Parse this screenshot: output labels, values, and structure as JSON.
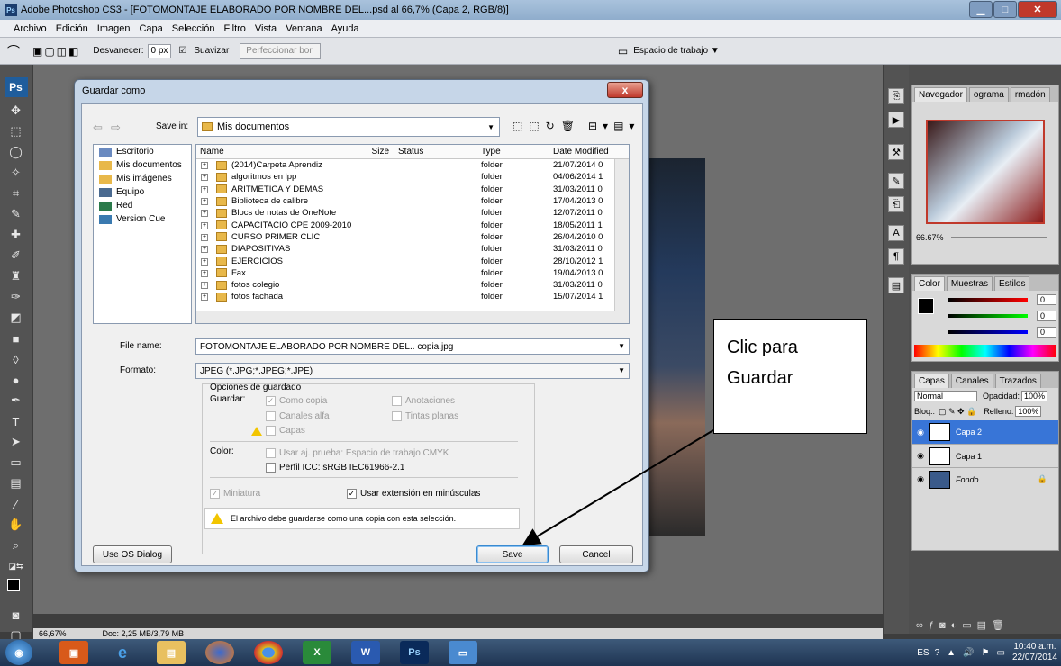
{
  "window": {
    "title": "Adobe Photoshop CS3 - [FOTOMONTAJE ELABORADO POR NOMBRE DEL...psd al 66,7% (Capa 2, RGB/8)]",
    "app_icon": "Ps"
  },
  "menu": [
    "Archivo",
    "Edición",
    "Imagen",
    "Capa",
    "Selección",
    "Filtro",
    "Vista",
    "Ventana",
    "Ayuda"
  ],
  "options_bar": {
    "feather_label": "Desvanecer:",
    "feather_value": "0 px",
    "antialias_label": "Suavizar",
    "refine_button": "Perfeccionar bor.",
    "workspace_label": "Espacio de trabajo ▼"
  },
  "tools_logo": "Ps",
  "status_bar": {
    "zoom": "66,67%",
    "doc": "Doc: 2,25 MB/3,79 MB"
  },
  "dialog": {
    "title": "Guardar como",
    "close": "x",
    "save_in_label": "Save in:",
    "save_in_value": "Mis documentos",
    "places": [
      "Escritorio",
      "Mis documentos",
      "Mis imágenes",
      "Equipo",
      "Red",
      "Version Cue"
    ],
    "columns": {
      "name": "Name",
      "size": "Size",
      "status": "Status",
      "type": "Type",
      "date": "Date Modified"
    },
    "files": [
      {
        "name": "(2014)Carpeta Aprendiz",
        "type": "folder",
        "date": "21/07/2014 0"
      },
      {
        "name": "algoritmos en lpp",
        "type": "folder",
        "date": "04/06/2014 1"
      },
      {
        "name": "ARITMETICA Y DEMAS",
        "type": "folder",
        "date": "31/03/2011 0"
      },
      {
        "name": "Biblioteca de calibre",
        "type": "folder",
        "date": "17/04/2013 0"
      },
      {
        "name": "Blocs de notas de OneNote",
        "type": "folder",
        "date": "12/07/2011 0"
      },
      {
        "name": "CAPACITACIO CPE 2009-2010",
        "type": "folder",
        "date": "18/05/2011 1"
      },
      {
        "name": "CURSO PRIMER CLIC",
        "type": "folder",
        "date": "26/04/2010 0"
      },
      {
        "name": "DIAPOSITIVAS",
        "type": "folder",
        "date": "31/03/2011 0"
      },
      {
        "name": "EJERCICIOS",
        "type": "folder",
        "date": "28/10/2012 1"
      },
      {
        "name": "Fax",
        "type": "folder",
        "date": "19/04/2013 0"
      },
      {
        "name": "fotos colegio",
        "type": "folder",
        "date": "31/03/2011 0"
      },
      {
        "name": "fotos fachada",
        "type": "folder",
        "date": "15/07/2014 1"
      }
    ],
    "file_name_label": "File name:",
    "file_name_value": "FOTOMONTAJE ELABORADO POR NOMBRE DEL.. copia.jpg",
    "format_label": "Formato:",
    "format_value": "JPEG (*.JPG;*.JPEG;*.JPE)",
    "save_options_title": "Opciones de guardado",
    "save_label": "Guardar:",
    "opt_as_copy": "Como copia",
    "opt_annotations": "Anotaciones",
    "opt_alpha": "Canales alfa",
    "opt_spot": "Tintas planas",
    "opt_layers": "Capas",
    "color_label": "Color:",
    "opt_proof": "Usar aj. prueba: Espacio de trabajo CMYK",
    "opt_icc": "Perfil ICC: sRGB IEC61966-2.1",
    "opt_thumbnail": "Miniatura",
    "opt_lowercase": "Usar extensión en minúsculas",
    "warning": "El archivo debe guardarse como una copia con esta selección.",
    "os_dialog_button": "Use OS Dialog",
    "save_button": "Save",
    "cancel_button": "Cancel"
  },
  "callout": {
    "line1": "Clic para",
    "line2": "Guardar"
  },
  "navigator": {
    "tabs": [
      "Navegador",
      "ograma",
      "rmadón"
    ],
    "zoom": "66.67%"
  },
  "color_panel": {
    "tabs": [
      "Color",
      "Muestras",
      "Estilos"
    ],
    "r": "0",
    "g": "0",
    "b": "0"
  },
  "layers_panel": {
    "tabs": [
      "Capas",
      "Canales",
      "Trazados"
    ],
    "mode": "Normal",
    "opacity_label": "Opacidad:",
    "opacity": "100%",
    "lock_label": "Bloq.:",
    "fill_label": "Relleno:",
    "fill": "100%",
    "layers": [
      "Capa 2",
      "Capa 1",
      "Fondo"
    ]
  },
  "taskbar": {
    "lang": "ES",
    "time": "10:40 a.m.",
    "date": "22/07/2014",
    "ps_label": "Ps"
  }
}
